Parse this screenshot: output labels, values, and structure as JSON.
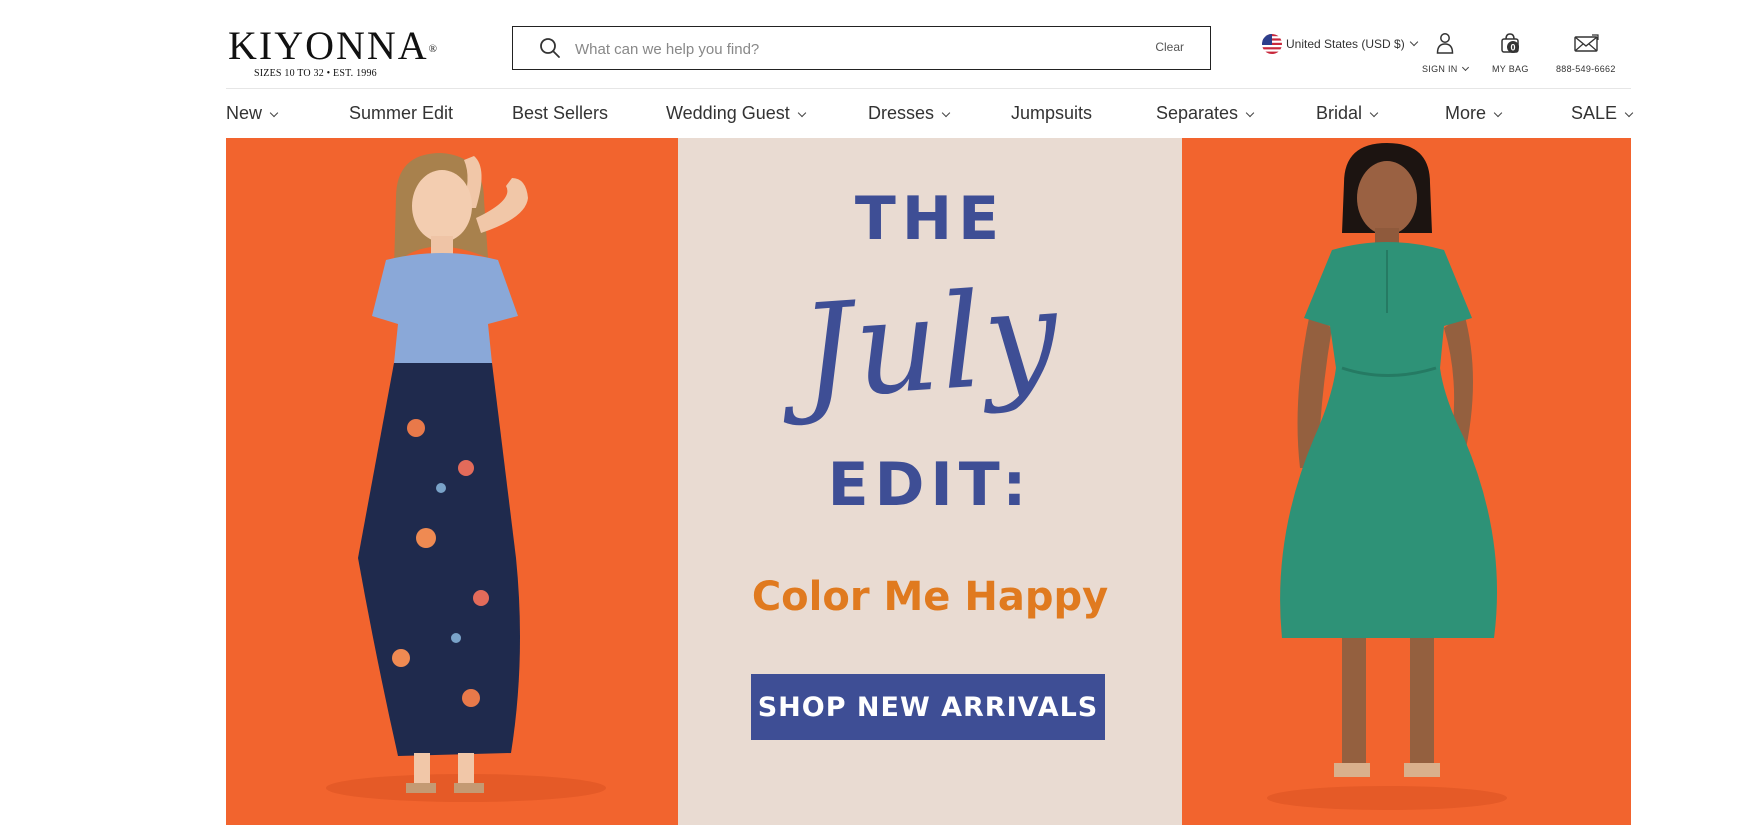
{
  "header": {
    "logo": {
      "name": "KIYONNA",
      "reg_mark": "®",
      "tagline": "SIZES 10 TO 32  •  EST. 1996"
    },
    "search": {
      "placeholder": "What can we help you find?",
      "value": "",
      "clear_label": "Clear"
    },
    "country": {
      "label": "United States (USD $)",
      "flag_icon": "us-flag-icon"
    },
    "sign_in": {
      "label": "SIGN IN",
      "icon": "user-icon"
    },
    "bag": {
      "label": "MY BAG",
      "count": "0",
      "icon": "shopping-bag-icon"
    },
    "phone": {
      "label": "888-549-6662",
      "icon": "envelope-phone-icon"
    }
  },
  "nav": {
    "items": [
      {
        "label": "New",
        "has_dropdown": true
      },
      {
        "label": "Summer Edit",
        "has_dropdown": false
      },
      {
        "label": "Best Sellers",
        "has_dropdown": false
      },
      {
        "label": "Wedding Guest",
        "has_dropdown": true
      },
      {
        "label": "Dresses",
        "has_dropdown": true
      },
      {
        "label": "Jumpsuits",
        "has_dropdown": false
      },
      {
        "label": "Separates",
        "has_dropdown": true
      },
      {
        "label": "Bridal",
        "has_dropdown": true
      },
      {
        "label": "More",
        "has_dropdown": true
      },
      {
        "label": "SALE",
        "has_dropdown": true
      }
    ]
  },
  "hero": {
    "line1": "THE",
    "line2": "July",
    "line3": "EDIT:",
    "subtitle": "Color Me Happy",
    "cta_label": "SHOP NEW ARRIVALS"
  },
  "colors": {
    "brand_blue": "#3e4e95",
    "hero_orange": "#f2642e",
    "subtitle_orange": "#e07a1f",
    "hero_beige": "#e9dbd2",
    "model_top_blue": "#8aa8d8",
    "model_skirt_navy": "#1f2a4d",
    "model_dress_green": "#2e9277"
  }
}
